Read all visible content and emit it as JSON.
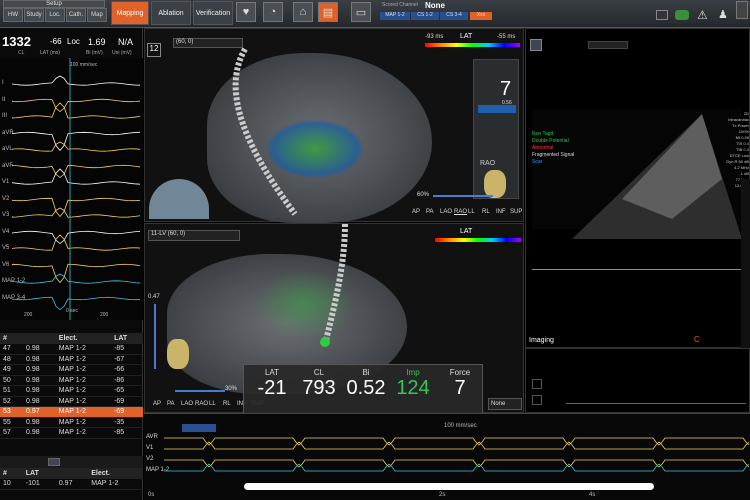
{
  "toolbar": {
    "small_tabs": [
      "Setup",
      "HW",
      "Study",
      "Loc.",
      "Cath.",
      "Map"
    ],
    "main_tabs": [
      "Mapping",
      "Ablation",
      "Verification"
    ],
    "active_tab": "Mapping",
    "scored_channel_label": "Scored Channel",
    "scored_channel_value": "None",
    "channel_buttons": [
      "MAP 1-2",
      "CS 1-2",
      "CS 3-4",
      "Xxx"
    ]
  },
  "left_panel": {
    "cl_value": "1332",
    "cl_label": "CL",
    "lat_value": "-66",
    "lat_label": "LAT (ms)",
    "loc_label": "Loc",
    "bi_value": "1.69",
    "bi_label": "Bi (mV)",
    "uni_value": "N/A",
    "uni_label": "Uni (mV)",
    "ecg_leads": [
      "I",
      "II",
      "III",
      "aVR",
      "aVL",
      "aVF",
      "V1",
      "V2",
      "V3",
      "V4",
      "V5",
      "V6",
      "MAP 1-2",
      "MAP 3-4"
    ],
    "speed_label": "100 mm/sec",
    "time_labels": [
      "200",
      "0 sec",
      "200"
    ],
    "table_headers": [
      "#",
      "",
      "Elect.",
      "LAT"
    ],
    "points": [
      {
        "n": "47",
        "bi": "0.98",
        "el": "MAP 1-2",
        "lat": "-85"
      },
      {
        "n": "48",
        "bi": "0.98",
        "el": "MAP 1-2",
        "lat": "-67"
      },
      {
        "n": "49",
        "bi": "0.98",
        "el": "MAP 1-2",
        "lat": "-66"
      },
      {
        "n": "50",
        "bi": "0.98",
        "el": "MAP 1-2",
        "lat": "-86"
      },
      {
        "n": "51",
        "bi": "0.98",
        "el": "MAP 1-2",
        "lat": "-65"
      },
      {
        "n": "52",
        "bi": "0.98",
        "el": "MAP 1-2",
        "lat": "-69"
      },
      {
        "n": "53",
        "bi": "0.97",
        "el": "MAP 1-2",
        "lat": "-69"
      },
      {
        "n": "55",
        "bi": "0.98",
        "el": "MAP 1-2",
        "lat": "-35"
      },
      {
        "n": "57",
        "bi": "0.98",
        "el": "MAP 1-2",
        "lat": "-85"
      }
    ],
    "bottom_headers": [
      "#",
      "LAT",
      "",
      "Elect."
    ],
    "bottom_row": {
      "n": "10",
      "lat": "-101",
      "bi": "0.97",
      "el": "MAP 1-2"
    }
  },
  "map_top": {
    "name": "12",
    "dropdown": "(60, 0)",
    "scale_left": "-93 ms",
    "scale_title": "LAT",
    "scale_right": "-55 ms",
    "zoom_value": "7",
    "zoom_sub": "0.56",
    "view_label": "RAO",
    "opacity": "60%",
    "views": [
      "AP",
      "PA",
      "LAO",
      "RAO",
      "LL",
      "RL",
      "INF",
      "SUP"
    ]
  },
  "map_bottom": {
    "dropdown": "11-LV (60, 0)",
    "scale_title": "LAT",
    "left_value": "0.47",
    "opacity": "30%",
    "views": [
      "AP",
      "PA",
      "LAO",
      "RAO",
      "LL",
      "RL",
      "INF",
      "SUP"
    ],
    "none_select": "None"
  },
  "readout": {
    "labels": [
      "LAT",
      "CL",
      "Bi",
      "Imp",
      "Force"
    ],
    "values": [
      "-21",
      "793",
      "0.52",
      "124",
      "7"
    ]
  },
  "imaging": {
    "label": "Imaging",
    "legend": [
      "Non Tagd",
      "Double Potential",
      "Abnormal",
      "Fragmented Signal",
      "Scar"
    ],
    "legend_colors": [
      "#2ecc40",
      "#2ecc40",
      "#ff3333",
      "#dddddd",
      "#3399ff"
    ],
    "info_lines": [
      "2D",
      "Intracardiac",
      "Tx Power 100%",
      "MI 0.99",
      "TIS 0.4",
      "TIB 0.4",
      "DTCE Low",
      "Dyn R 60 dB",
      "4.2 MHz",
      "-1 dB",
      "77 bpm",
      "12.0 cm"
    ]
  },
  "bottom_strip": {
    "speed_label": "100 mm/sec",
    "leads": [
      "AVR",
      "V1",
      "V2",
      "MAP 1-2"
    ],
    "time_labels": [
      "0s",
      "2s",
      "4s"
    ],
    "marker_label": "10"
  },
  "colors": {
    "accent": "#e0622a",
    "imp_green": "#35c759",
    "ecg_yellow": "#f4d35e",
    "ecg_cyan": "#3fc6e0"
  }
}
